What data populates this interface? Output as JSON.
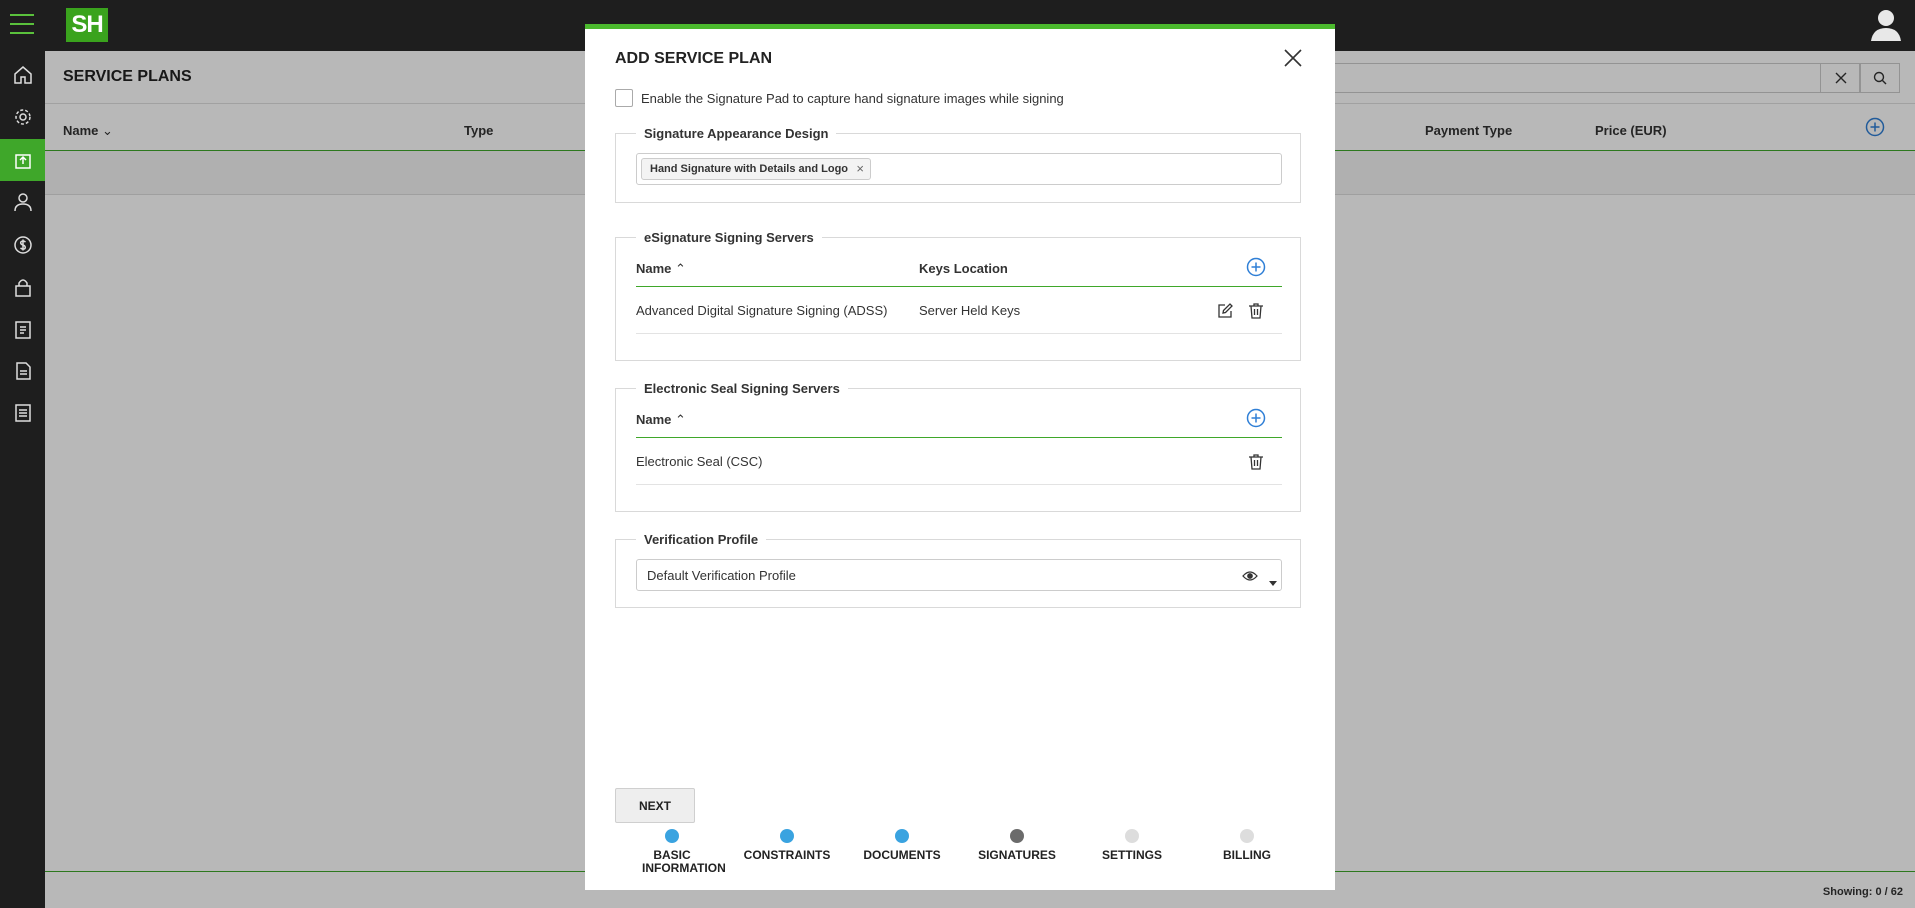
{
  "page": {
    "title": "SERVICE PLANS",
    "columns": [
      "Name",
      "Type",
      "Payment Type",
      "Price (EUR)"
    ],
    "showing": "Showing: 0 / 62"
  },
  "modal": {
    "title": "ADD SERVICE PLAN",
    "sig_pad_label": "Enable the Signature Pad to capture hand signature images while signing",
    "appearance": {
      "legend": "Signature Appearance Design",
      "tag": "Hand Signature with Details and Logo"
    },
    "esig_servers": {
      "legend": "eSignature Signing Servers",
      "col_name": "Name",
      "col_keys": "Keys Location",
      "rows": [
        {
          "name": "Advanced Digital Signature Signing (ADSS)",
          "keys": "Server Held Keys"
        }
      ]
    },
    "seal_servers": {
      "legend": "Electronic Seal Signing Servers",
      "col_name": "Name",
      "rows": [
        {
          "name": "Electronic Seal (CSC)"
        }
      ]
    },
    "verification": {
      "legend": "Verification Profile",
      "value": "Default Verification Profile"
    },
    "next_label": "NEXT",
    "steps": [
      {
        "label": "BASIC INFORMATION",
        "state": "done",
        "color": "#3aa3e0"
      },
      {
        "label": "CONSTRAINTS",
        "state": "done",
        "color": "#3aa3e0"
      },
      {
        "label": "DOCUMENTS",
        "state": "done",
        "color": "#3aa3e0"
      },
      {
        "label": "SIGNATURES",
        "state": "current",
        "color": "#6b6b6b"
      },
      {
        "label": "SETTINGS",
        "state": "pending",
        "color": "#dddddd"
      },
      {
        "label": "BILLING",
        "state": "pending",
        "color": "#dddddd"
      }
    ]
  },
  "colors": {
    "brand_green": "#3fa72a",
    "accent_blue": "#2f7fd6",
    "header_dark": "#1e1e1e"
  }
}
